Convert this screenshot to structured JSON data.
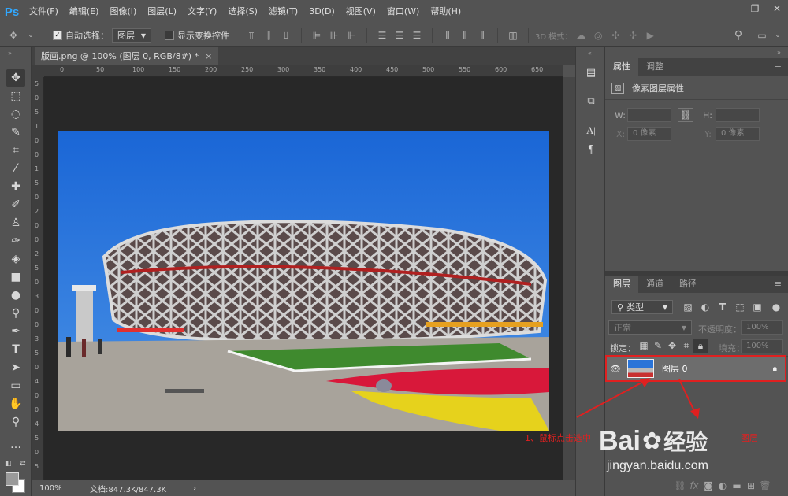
{
  "app": {
    "logo": "Ps"
  },
  "menu": [
    "文件(F)",
    "编辑(E)",
    "图像(I)",
    "图层(L)",
    "文字(Y)",
    "选择(S)",
    "滤镜(T)",
    "3D(D)",
    "视图(V)",
    "窗口(W)",
    "帮助(H)"
  ],
  "options_bar": {
    "auto_select_label": "自动选择：",
    "auto_select_value": "图层",
    "show_transform_label": "显示变换控件",
    "mode_3d_label": "3D 模式："
  },
  "document": {
    "tab_title": "版画.png @ 100% (图层 0, RGB/8#) *",
    "close": "×"
  },
  "ruler": {
    "h": [
      "0",
      "50",
      "100",
      "150",
      "200",
      "250",
      "300",
      "350",
      "400",
      "450",
      "500",
      "550",
      "600",
      "650"
    ],
    "v": [
      "5",
      "0",
      "5",
      "1",
      "0",
      "0",
      "1",
      "5",
      "0",
      "2",
      "0",
      "0",
      "2",
      "5",
      "0",
      "3",
      "0",
      "0",
      "3",
      "5",
      "0",
      "4",
      "0",
      "0",
      "4",
      "5",
      "0",
      "5"
    ]
  },
  "status": {
    "zoom": "100%",
    "doc_info": "文档:847.3K/847.3K",
    "arrow": "›"
  },
  "properties_panel": {
    "tabs": [
      "属性",
      "调整"
    ],
    "title": "像素图层属性",
    "w_label": "W:",
    "h_label": "H:",
    "x_label": "X:",
    "y_label": "Y:",
    "x_placeholder": "0 像素",
    "y_placeholder": "0 像素"
  },
  "layers_panel": {
    "tabs": [
      "图层",
      "通道",
      "路径"
    ],
    "filter_value": "类型",
    "blend_mode": "正常",
    "opacity_label": "不透明度：",
    "opacity_value": "100%",
    "lock_label": "锁定：",
    "fill_label": "填充：",
    "fill_value": "100%",
    "layer_name": "图层 0"
  },
  "annotations": {
    "step1": "1、鼠标点击选中",
    "step2": "图层"
  },
  "watermark": {
    "brand": "Bai",
    "sub": "jingyan.baidu.com",
    "jy": "经验"
  },
  "colors": {
    "highlight": "#e02020",
    "ps_blue": "#31a8ff",
    "sky": "#1f6fd8"
  }
}
